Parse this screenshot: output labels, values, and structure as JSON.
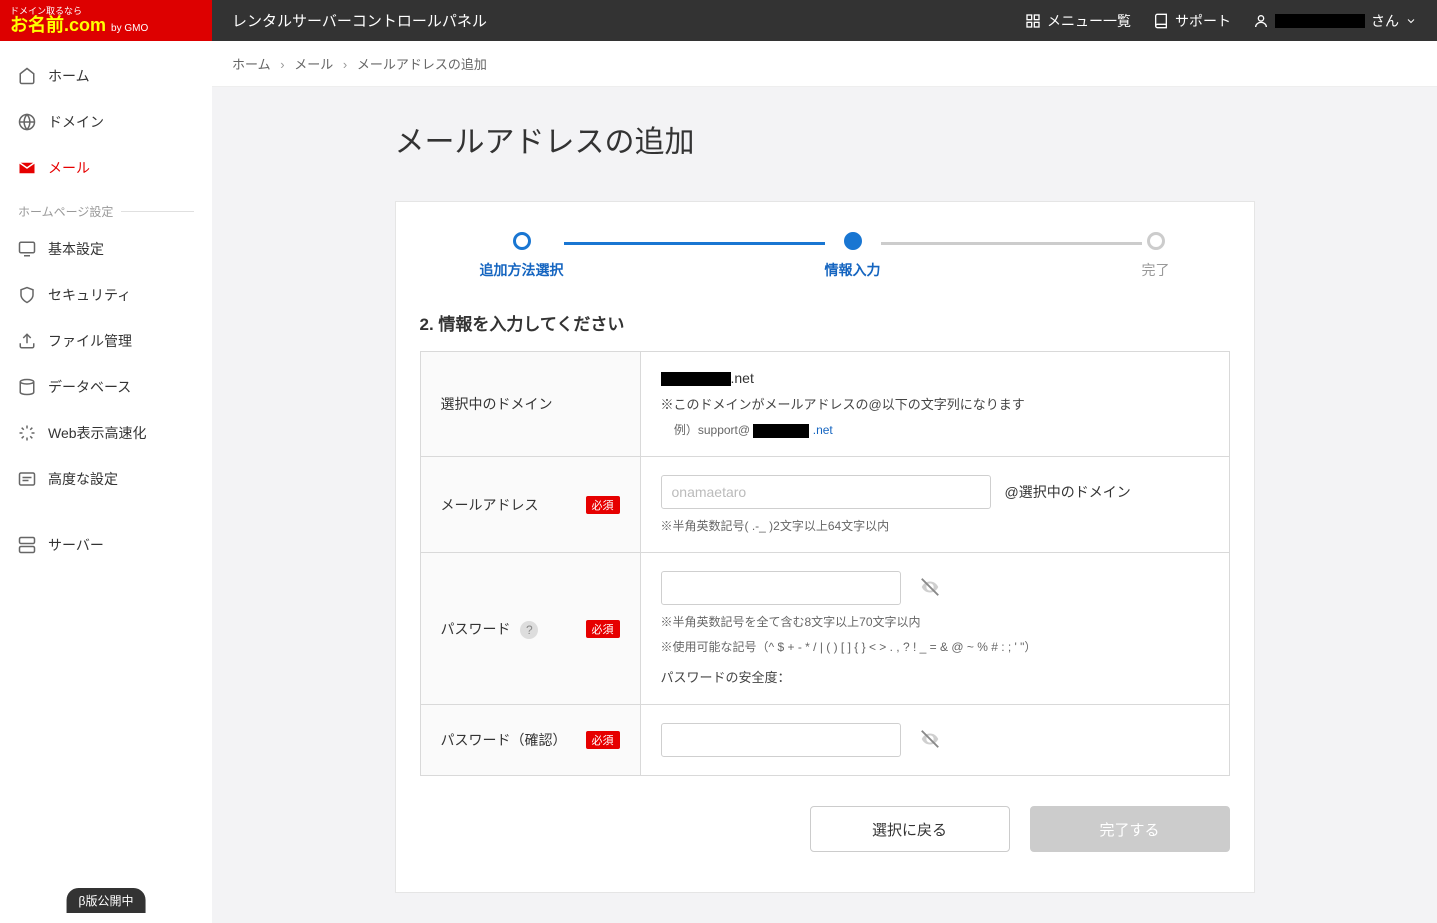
{
  "header": {
    "logo_top": "ドメイン取るなら",
    "logo_main": "お名前",
    "logo_com": ".com",
    "logo_gmo": "by GMO",
    "title": "レンタルサーバーコントロールパネル",
    "menu_list": "メニュー一覧",
    "menu_support": "サポート",
    "user_suffix": "さん"
  },
  "sidebar": {
    "items": [
      {
        "label": "ホーム"
      },
      {
        "label": "ドメイン"
      },
      {
        "label": "メール"
      }
    ],
    "section_hp": "ホームページ設定",
    "hp_items": [
      {
        "label": "基本設定"
      },
      {
        "label": "セキュリティ"
      },
      {
        "label": "ファイル管理"
      },
      {
        "label": "データベース"
      },
      {
        "label": "Web表示高速化"
      },
      {
        "label": "高度な設定"
      }
    ],
    "server_label": "サーバー",
    "beta": "β版公開中"
  },
  "breadcrumbs": {
    "home": "ホーム",
    "mail": "メール",
    "current": "メールアドレスの追加"
  },
  "page": {
    "title": "メールアドレスの追加"
  },
  "stepper": {
    "step1": "追加方法選択",
    "step2": "情報入力",
    "step3": "完了"
  },
  "form": {
    "section_title": "2. 情報を入力してください",
    "required_badge": "必須",
    "domain_label": "選択中のドメイン",
    "domain_value_suffix": ".net",
    "domain_note": "※このドメインがメールアドレスの@以下の文字列になります",
    "domain_example_prefix": "例）support@ ",
    "domain_example_suffix": ".net",
    "email_label": "メールアドレス",
    "email_placeholder": "onamaetaro",
    "email_at": "@選択中のドメイン",
    "email_note": "※半角英数記号( .-_ )2文字以上64文字以内",
    "password_label": "パスワード",
    "password_note1": "※半角英数記号を全て含む8文字以上70文字以内",
    "password_note2": "※使用可能な記号（^ $ + - * / | ( ) [ ] { } < > . , ? ! _ = & @ ~ % # : ; ' \"）",
    "password_strength": "パスワードの安全度：",
    "password_confirm_label": "パスワード（確認）"
  },
  "buttons": {
    "back": "選択に戻る",
    "submit": "完了する"
  }
}
